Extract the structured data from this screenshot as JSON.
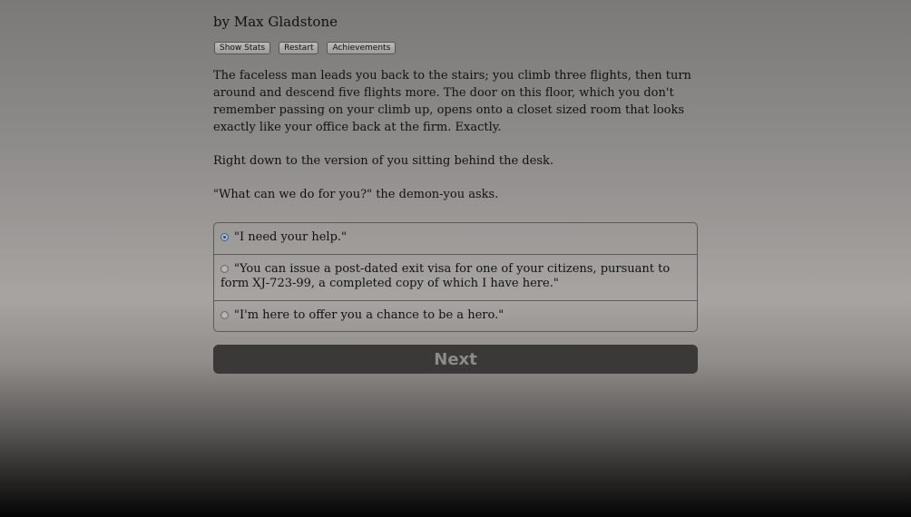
{
  "header": {
    "byline": "by Max Gladstone"
  },
  "toolbar": {
    "show_stats_label": "Show Stats",
    "restart_label": "Restart",
    "achievements_label": "Achievements"
  },
  "story": {
    "paragraphs": [
      "The faceless man leads you back to the stairs; you climb three flights, then turn around and descend five flights more. The door on this floor, which you don't remember passing on your climb up, opens onto a closet sized room that looks exactly like your office back at the firm. Exactly.",
      "Right down to the version of you sitting behind the desk.",
      "\"What can we do for you?\" the demon-you asks."
    ]
  },
  "choices": [
    {
      "label": "\"I need your help.\"",
      "selected": true
    },
    {
      "label": "\"You can issue a post-dated exit visa for one of your citizens, pursuant to form XJ-723-99, a completed copy of which I have here.\"",
      "selected": false
    },
    {
      "label": "\"I'm here to offer you a chance to be a hero.\"",
      "selected": false
    }
  ],
  "next_button": {
    "label": "Next"
  }
}
